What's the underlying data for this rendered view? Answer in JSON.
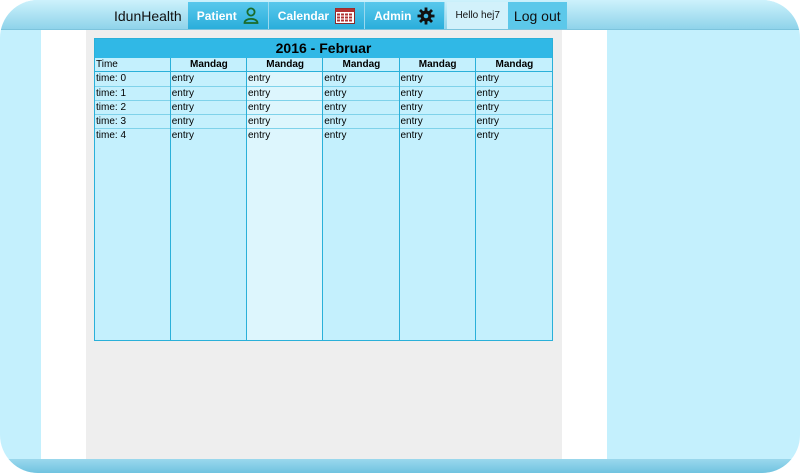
{
  "nav": {
    "brand": "IdunHealth",
    "patient_label": "Patient",
    "calendar_label": "Calendar",
    "admin_label": "Admin",
    "hello_text": "Hello hej7",
    "logout_label": "Log out",
    "icons": {
      "patient": "person-outline-icon",
      "calendar": "calendar-grid-icon",
      "admin": "gear-icon"
    }
  },
  "calendar": {
    "title": "2016 - Februar",
    "time_header": "Time",
    "day_headers": [
      "Mandag",
      "Mandag",
      "Mandag",
      "Mandag",
      "Mandag"
    ],
    "times": [
      "time: 0",
      "time: 1",
      "time: 2",
      "time: 3",
      "time: 4"
    ],
    "entries": [
      [
        "entry",
        "entry",
        "entry",
        "entry",
        "entry"
      ],
      [
        "entry",
        "entry",
        "entry",
        "entry",
        "entry"
      ],
      [
        "entry",
        "entry",
        "entry",
        "entry",
        "entry"
      ],
      [
        "entry",
        "entry",
        "entry",
        "entry",
        "entry"
      ],
      [
        "entry",
        "entry",
        "entry",
        "entry",
        "entry"
      ]
    ]
  },
  "colors": {
    "background": "#c4f0fd",
    "accent": "#30b8e6",
    "content": "#eeeeee"
  }
}
